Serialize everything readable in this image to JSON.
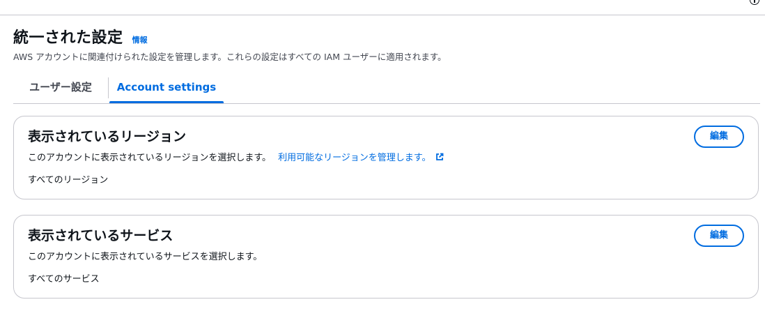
{
  "header": {
    "title": "統一された設定",
    "info_link": "情報",
    "description": "AWS アカウントに関連付けられた設定を管理します。これらの設定はすべての IAM ユーザーに適用されます。"
  },
  "tabs": [
    {
      "label": "ユーザー設定",
      "selected": false
    },
    {
      "label": "Account settings",
      "selected": true
    }
  ],
  "regions_card": {
    "title": "表示されているリージョン",
    "description": "このアカウントに表示されているリージョンを選択します。",
    "manage_link": "利用可能なリージョンを管理します。",
    "manage_link_icon": "external-link-icon",
    "value": "すべてのリージョン",
    "edit_label": "編集"
  },
  "services_card": {
    "title": "表示されているサービス",
    "description": "このアカウントに表示されているサービスを選択します。",
    "value": "すべてのサービス",
    "edit_label": "編集"
  },
  "colors": {
    "accent": "#006ce0",
    "text": "#0f141a",
    "border": "#c6c6cd"
  }
}
